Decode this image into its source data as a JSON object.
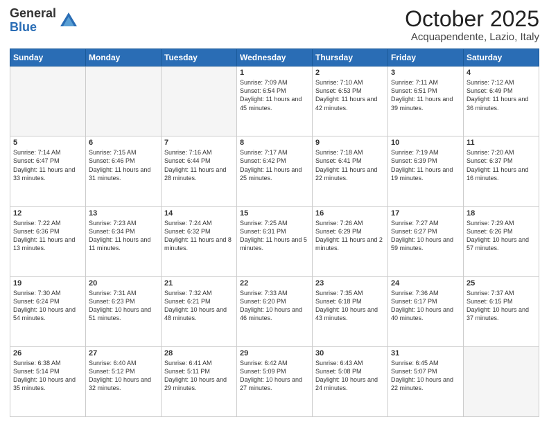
{
  "logo": {
    "general": "General",
    "blue": "Blue"
  },
  "title": "October 2025",
  "location": "Acquapendente, Lazio, Italy",
  "days_header": [
    "Sunday",
    "Monday",
    "Tuesday",
    "Wednesday",
    "Thursday",
    "Friday",
    "Saturday"
  ],
  "weeks": [
    [
      {
        "day": "",
        "info": ""
      },
      {
        "day": "",
        "info": ""
      },
      {
        "day": "",
        "info": ""
      },
      {
        "day": "1",
        "info": "Sunrise: 7:09 AM\nSunset: 6:54 PM\nDaylight: 11 hours and 45 minutes."
      },
      {
        "day": "2",
        "info": "Sunrise: 7:10 AM\nSunset: 6:53 PM\nDaylight: 11 hours and 42 minutes."
      },
      {
        "day": "3",
        "info": "Sunrise: 7:11 AM\nSunset: 6:51 PM\nDaylight: 11 hours and 39 minutes."
      },
      {
        "day": "4",
        "info": "Sunrise: 7:12 AM\nSunset: 6:49 PM\nDaylight: 11 hours and 36 minutes."
      }
    ],
    [
      {
        "day": "5",
        "info": "Sunrise: 7:14 AM\nSunset: 6:47 PM\nDaylight: 11 hours and 33 minutes."
      },
      {
        "day": "6",
        "info": "Sunrise: 7:15 AM\nSunset: 6:46 PM\nDaylight: 11 hours and 31 minutes."
      },
      {
        "day": "7",
        "info": "Sunrise: 7:16 AM\nSunset: 6:44 PM\nDaylight: 11 hours and 28 minutes."
      },
      {
        "day": "8",
        "info": "Sunrise: 7:17 AM\nSunset: 6:42 PM\nDaylight: 11 hours and 25 minutes."
      },
      {
        "day": "9",
        "info": "Sunrise: 7:18 AM\nSunset: 6:41 PM\nDaylight: 11 hours and 22 minutes."
      },
      {
        "day": "10",
        "info": "Sunrise: 7:19 AM\nSunset: 6:39 PM\nDaylight: 11 hours and 19 minutes."
      },
      {
        "day": "11",
        "info": "Sunrise: 7:20 AM\nSunset: 6:37 PM\nDaylight: 11 hours and 16 minutes."
      }
    ],
    [
      {
        "day": "12",
        "info": "Sunrise: 7:22 AM\nSunset: 6:36 PM\nDaylight: 11 hours and 13 minutes."
      },
      {
        "day": "13",
        "info": "Sunrise: 7:23 AM\nSunset: 6:34 PM\nDaylight: 11 hours and 11 minutes."
      },
      {
        "day": "14",
        "info": "Sunrise: 7:24 AM\nSunset: 6:32 PM\nDaylight: 11 hours and 8 minutes."
      },
      {
        "day": "15",
        "info": "Sunrise: 7:25 AM\nSunset: 6:31 PM\nDaylight: 11 hours and 5 minutes."
      },
      {
        "day": "16",
        "info": "Sunrise: 7:26 AM\nSunset: 6:29 PM\nDaylight: 11 hours and 2 minutes."
      },
      {
        "day": "17",
        "info": "Sunrise: 7:27 AM\nSunset: 6:27 PM\nDaylight: 10 hours and 59 minutes."
      },
      {
        "day": "18",
        "info": "Sunrise: 7:29 AM\nSunset: 6:26 PM\nDaylight: 10 hours and 57 minutes."
      }
    ],
    [
      {
        "day": "19",
        "info": "Sunrise: 7:30 AM\nSunset: 6:24 PM\nDaylight: 10 hours and 54 minutes."
      },
      {
        "day": "20",
        "info": "Sunrise: 7:31 AM\nSunset: 6:23 PM\nDaylight: 10 hours and 51 minutes."
      },
      {
        "day": "21",
        "info": "Sunrise: 7:32 AM\nSunset: 6:21 PM\nDaylight: 10 hours and 48 minutes."
      },
      {
        "day": "22",
        "info": "Sunrise: 7:33 AM\nSunset: 6:20 PM\nDaylight: 10 hours and 46 minutes."
      },
      {
        "day": "23",
        "info": "Sunrise: 7:35 AM\nSunset: 6:18 PM\nDaylight: 10 hours and 43 minutes."
      },
      {
        "day": "24",
        "info": "Sunrise: 7:36 AM\nSunset: 6:17 PM\nDaylight: 10 hours and 40 minutes."
      },
      {
        "day": "25",
        "info": "Sunrise: 7:37 AM\nSunset: 6:15 PM\nDaylight: 10 hours and 37 minutes."
      }
    ],
    [
      {
        "day": "26",
        "info": "Sunrise: 6:38 AM\nSunset: 5:14 PM\nDaylight: 10 hours and 35 minutes."
      },
      {
        "day": "27",
        "info": "Sunrise: 6:40 AM\nSunset: 5:12 PM\nDaylight: 10 hours and 32 minutes."
      },
      {
        "day": "28",
        "info": "Sunrise: 6:41 AM\nSunset: 5:11 PM\nDaylight: 10 hours and 29 minutes."
      },
      {
        "day": "29",
        "info": "Sunrise: 6:42 AM\nSunset: 5:09 PM\nDaylight: 10 hours and 27 minutes."
      },
      {
        "day": "30",
        "info": "Sunrise: 6:43 AM\nSunset: 5:08 PM\nDaylight: 10 hours and 24 minutes."
      },
      {
        "day": "31",
        "info": "Sunrise: 6:45 AM\nSunset: 5:07 PM\nDaylight: 10 hours and 22 minutes."
      },
      {
        "day": "",
        "info": ""
      }
    ]
  ]
}
